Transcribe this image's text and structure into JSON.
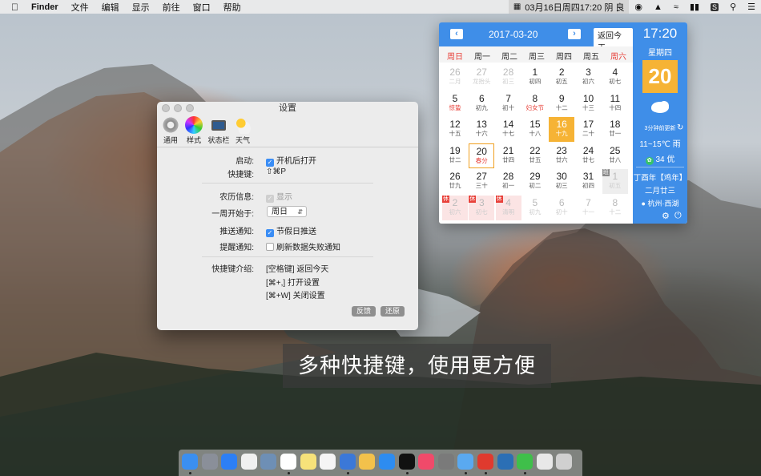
{
  "menubar": {
    "apple_icon": "apple-icon",
    "app_name": "Finder",
    "menus": [
      "文件",
      "编辑",
      "显示",
      "前往",
      "窗口",
      "帮助"
    ],
    "clock_text": "03月16日周四17:20 阴 良",
    "right_icons": [
      "calendar-icon",
      "wechat-icon",
      "qq-bell-icon",
      "wifi-icon",
      "battery-icon",
      "app-s-icon",
      "search-icon",
      "list-icon"
    ]
  },
  "settings": {
    "title": "设置",
    "toolbar": [
      {
        "label": "通用",
        "icon": "gear-icon"
      },
      {
        "label": "样式",
        "icon": "color-wheel-icon"
      },
      {
        "label": "状态栏",
        "icon": "laptop-icon"
      },
      {
        "label": "天气",
        "icon": "weather-icon"
      }
    ],
    "startup_label": "启动:",
    "startup_value": "开机后打开",
    "hotkey_label": "快捷键:",
    "hotkey_value": "⇧⌘P",
    "lunar_label": "农历信息:",
    "lunar_value": "显示",
    "week_start_label": "一周开始于:",
    "week_start_value": "周日",
    "push_label": "推送通知:",
    "push_value": "节假日推送",
    "remind_label": "提醒通知:",
    "remind_value": "刷新数据失败通知",
    "shortcut_intro_label": "快捷键介绍:",
    "shortcut_lines": [
      "[空格键] 返回今天",
      "[⌘+,] 打开设置",
      "[⌘+W] 关闭设置"
    ],
    "feedback_button": "反馈",
    "restore_button": "还原"
  },
  "calendar": {
    "current_date": "2017-03-20",
    "prev_icon": "chevron-left-icon",
    "next_icon": "chevron-right-icon",
    "today_button": "返回今天",
    "weekdays": [
      "周日",
      "周一",
      "周二",
      "周三",
      "周四",
      "周五",
      "周六"
    ],
    "weeks": [
      [
        {
          "d": "26",
          "l": "二月",
          "o": true
        },
        {
          "d": "27",
          "l": "龙抬头",
          "o": true
        },
        {
          "d": "28",
          "l": "初三",
          "o": true
        },
        {
          "d": "1",
          "l": "初四"
        },
        {
          "d": "2",
          "l": "初五"
        },
        {
          "d": "3",
          "l": "初六"
        },
        {
          "d": "4",
          "l": "初七"
        }
      ],
      [
        {
          "d": "5",
          "l": "惊蛰",
          "r": true
        },
        {
          "d": "6",
          "l": "初九"
        },
        {
          "d": "7",
          "l": "初十"
        },
        {
          "d": "8",
          "l": "妇女节",
          "r": true
        },
        {
          "d": "9",
          "l": "十二"
        },
        {
          "d": "10",
          "l": "十三"
        },
        {
          "d": "11",
          "l": "十四"
        }
      ],
      [
        {
          "d": "12",
          "l": "十五"
        },
        {
          "d": "13",
          "l": "十六"
        },
        {
          "d": "14",
          "l": "十七"
        },
        {
          "d": "15",
          "l": "十八"
        },
        {
          "d": "16",
          "l": "十九",
          "sel": true
        },
        {
          "d": "17",
          "l": "二十"
        },
        {
          "d": "18",
          "l": "廿一"
        }
      ],
      [
        {
          "d": "19",
          "l": "廿二"
        },
        {
          "d": "20",
          "l": "春分",
          "r": true,
          "today": true
        },
        {
          "d": "21",
          "l": "廿四"
        },
        {
          "d": "22",
          "l": "廿五"
        },
        {
          "d": "23",
          "l": "廿六"
        },
        {
          "d": "24",
          "l": "廿七"
        },
        {
          "d": "25",
          "l": "廿八"
        }
      ],
      [
        {
          "d": "26",
          "l": "廿九"
        },
        {
          "d": "27",
          "l": "三十"
        },
        {
          "d": "28",
          "l": "初一"
        },
        {
          "d": "29",
          "l": "初二"
        },
        {
          "d": "30",
          "l": "初三"
        },
        {
          "d": "31",
          "l": "初四"
        },
        {
          "d": "1",
          "l": "初五",
          "o": true,
          "work": true,
          "tag": "班"
        }
      ],
      [
        {
          "d": "2",
          "l": "初六",
          "o": true,
          "hol": true,
          "tag": "休"
        },
        {
          "d": "3",
          "l": "初七",
          "o": true,
          "hol": true,
          "tag": "休"
        },
        {
          "d": "4",
          "l": "清明",
          "o": true,
          "hol": true,
          "tag": "休"
        },
        {
          "d": "5",
          "l": "初九",
          "o": true
        },
        {
          "d": "6",
          "l": "初十",
          "o": true
        },
        {
          "d": "7",
          "l": "十一",
          "o": true
        },
        {
          "d": "8",
          "l": "十二",
          "o": true
        }
      ]
    ],
    "side": {
      "time": "17:20",
      "weekday": "星期四",
      "day": "20",
      "weather_icon": "cloud-rain-icon",
      "update_note": "3分钟前更新",
      "refresh_icon": "refresh-icon",
      "temperature": "11~15℃",
      "weather": "雨",
      "aqi": "34 优",
      "ganzhi": "丁酉年【鸡年】",
      "lunar_date": "二月廿三",
      "location": "杭州·西湖",
      "settings_icon": "gear-icon",
      "power_icon": "power-icon"
    }
  },
  "caption": "多种快捷键，使用更方便",
  "dock": {
    "apps": [
      "finder-icon",
      "launchpad-icon",
      "safari-icon",
      "contacts-icon",
      "mail-icon",
      "calendar-icon",
      "notes-icon",
      "photos-icon",
      "keynote-icon",
      "stickies-icon",
      "appstore-icon",
      "qq-icon",
      "music-icon",
      "system-prefs-icon",
      "preview-icon",
      "netease-music-icon",
      "app-gear-icon",
      "wechat-icon",
      "document-icon",
      "trash-icon"
    ]
  }
}
